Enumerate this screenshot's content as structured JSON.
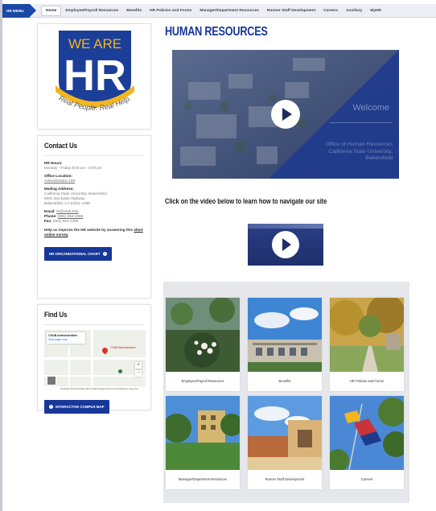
{
  "nav": {
    "menu_label": "HR MENU",
    "items": [
      {
        "label": "Home",
        "active": true
      },
      {
        "label": "Employee/Payroll Resources",
        "active": false
      },
      {
        "label": "Benefits",
        "active": false
      },
      {
        "label": "HR Policies and Forms",
        "active": false
      },
      {
        "label": "Manager/Department Resources",
        "active": false
      },
      {
        "label": "Runner Staff Development",
        "active": false
      },
      {
        "label": "Careers",
        "active": false
      },
      {
        "label": "Auxiliary",
        "active": false
      },
      {
        "label": "MyHR",
        "active": false
      }
    ]
  },
  "logo": {
    "top": "WE ARE",
    "big": "HR",
    "tagline": "Real People. Real Help.",
    "colors": {
      "blue": "#1b3f99",
      "gold": "#f3b61f"
    }
  },
  "contact": {
    "title": "Contact Us",
    "hours_label": "HR Hours:",
    "hours_value": "Monday - Friday 8:00 am - 5:00 pm",
    "location_label": "Office Location:",
    "location_value": "Administration 108",
    "mailing_label": "Mailing Address:",
    "mailing_lines": [
      "California State University, Bakersfield",
      "9001 Stockdale Highway",
      "Bakersfield, CA 93311-1099"
    ],
    "email_label": "Email:",
    "email_value": "hr@csub.edu",
    "phone_label": "Phone:",
    "phone_value": "(661) 654-2266",
    "fax_label": "Fax:",
    "fax_value": "(661) 654-2299",
    "improve_text": "Help us improve the HR website by answering this",
    "improve_link": "short online survey",
    "improve_end": ".",
    "chart_button": "HR ORGANIZATIONAL CHART"
  },
  "find": {
    "title": "Find Us",
    "map_title": "CSUB Administration",
    "map_link": "View larger map",
    "pin_label": "CSUB Administration",
    "zoom_in": "+",
    "zoom_out": "−",
    "map_footer": "Keyboard shortcuts   Map data ©2024 Google   Terms of Use   Report a map error",
    "map_button": "INTERACTIVE CAMPUS MAP"
  },
  "main": {
    "title": "HUMAN RESOURCES",
    "welcome": "Welcome",
    "welcome_sub": "Office of Human Resources California State University, Bakersfield",
    "subheading": "Click on the video below to learn how to navigate our site"
  },
  "tiles": [
    {
      "label": "Employee/Payroll Resources"
    },
    {
      "label": "Benefits"
    },
    {
      "label": "HR Policies and Forms"
    },
    {
      "label": "Manager/Department Resources"
    },
    {
      "label": "Runner Staff Development"
    },
    {
      "label": "Careers"
    }
  ]
}
